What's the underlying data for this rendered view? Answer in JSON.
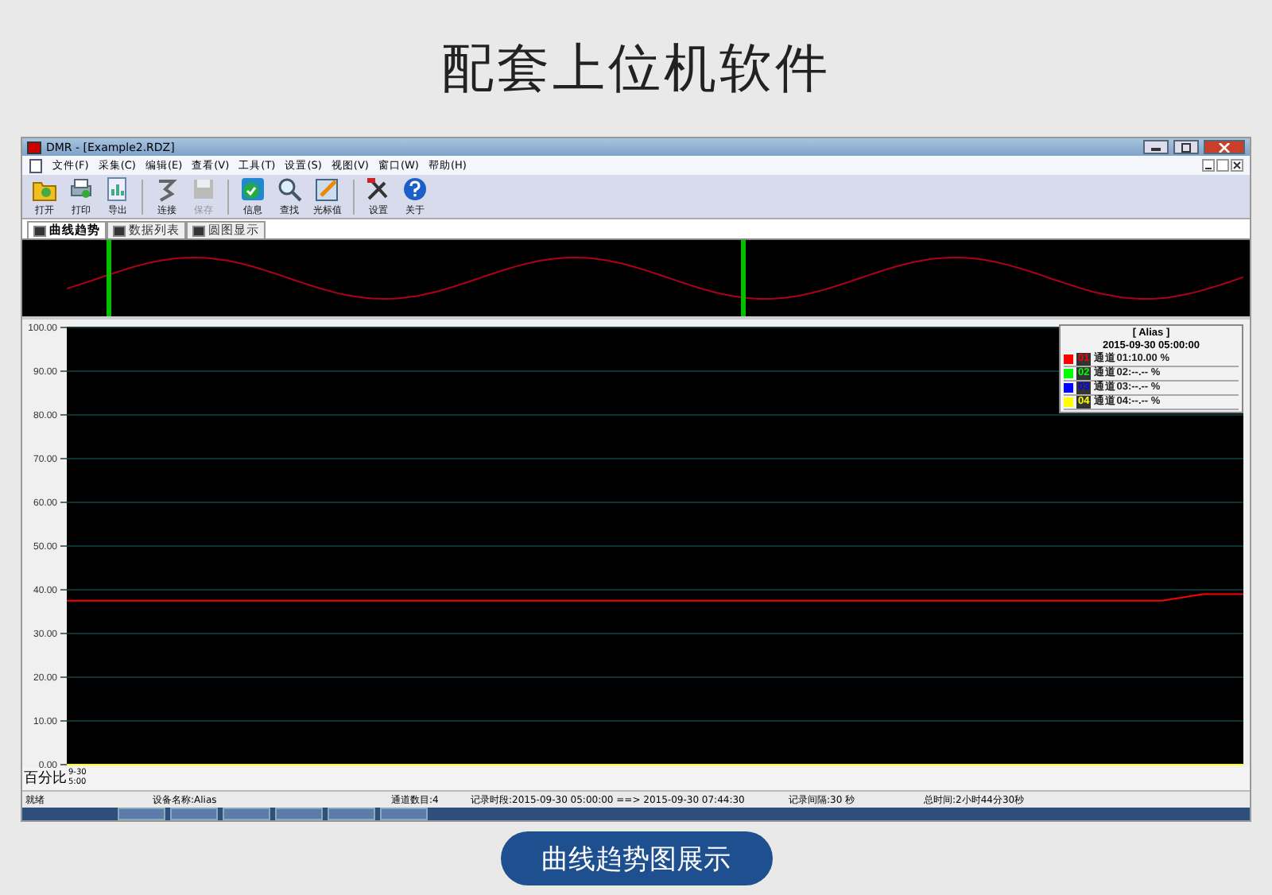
{
  "page_title": "配套上位机软件",
  "window": {
    "title": "DMR - [Example2.RDZ]"
  },
  "menu": [
    "文件(F)",
    "采集(C)",
    "编辑(E)",
    "查看(V)",
    "工具(T)",
    "设置(S)",
    "视图(V)",
    "窗口(W)",
    "帮助(H)"
  ],
  "toolbar": [
    {
      "kind": "open",
      "label": "打开",
      "disabled": false
    },
    {
      "kind": "print",
      "label": "打印",
      "disabled": false
    },
    {
      "kind": "export",
      "label": "导出",
      "disabled": false
    },
    {
      "kind": "connect",
      "label": "连接",
      "disabled": false
    },
    {
      "kind": "save",
      "label": "保存",
      "disabled": true
    },
    {
      "kind": "info",
      "label": "信息",
      "disabled": false
    },
    {
      "kind": "search",
      "label": "查找",
      "disabled": false
    },
    {
      "kind": "cursor",
      "label": "光标值",
      "disabled": false
    },
    {
      "kind": "settings",
      "label": "设置",
      "disabled": false
    },
    {
      "kind": "help",
      "label": "关于",
      "disabled": false
    }
  ],
  "tabs": [
    {
      "label": "曲线趋势",
      "selected": true
    },
    {
      "label": "数据列表",
      "selected": false
    },
    {
      "label": "圆图显示",
      "selected": false
    }
  ],
  "legend": {
    "title": "[ Alias    ]",
    "time": "2015-09-30 05:00:00",
    "channels": [
      {
        "reading": "通道01:10.00 %"
      },
      {
        "reading": "通道02:--.-- %"
      },
      {
        "reading": "通道03:--.-- %"
      },
      {
        "reading": "通道04:--.-- %"
      }
    ]
  },
  "chart_data": {
    "type": "line",
    "ylabel": "百分比",
    "ylim": [
      0,
      100
    ],
    "yticks": [
      {
        "value": 0,
        "label": "0.00"
      },
      {
        "value": 10,
        "label": "10.00"
      },
      {
        "value": 20,
        "label": "20.00"
      },
      {
        "value": 30,
        "label": "30.00"
      },
      {
        "value": 40,
        "label": "40.00"
      },
      {
        "value": 50,
        "label": "50.00"
      },
      {
        "value": 60,
        "label": "60.00"
      },
      {
        "value": 70,
        "label": "70.00"
      },
      {
        "value": 80,
        "label": "80.00"
      },
      {
        "value": 90,
        "label": "90.00"
      },
      {
        "value": 100,
        "label": "100.00"
      }
    ],
    "grid": true,
    "legend": true,
    "series": [
      {
        "name": "01",
        "color": "#ff0000",
        "values": [
          37.5,
          37.5,
          37.5,
          37.5,
          37.5,
          37.5,
          37.5,
          37.5,
          37.5,
          37.5,
          37.5,
          37.5,
          37.5,
          37.5,
          37.5,
          37.5,
          37.5,
          37.5,
          37.5,
          37.5,
          37.5,
          37.5,
          37.5,
          37.5,
          37.5,
          37.5,
          37.5,
          37.5,
          39,
          39
        ]
      },
      {
        "name": "02",
        "color": "#00ff00",
        "values": [
          null,
          null,
          null,
          null,
          null,
          null,
          null,
          null,
          null,
          null,
          null,
          null,
          null,
          null,
          null,
          null,
          null,
          null,
          null,
          null,
          null,
          null,
          null,
          null,
          null,
          null,
          null,
          null,
          null,
          null
        ]
      },
      {
        "name": "03",
        "color": "#0000ff",
        "values": [
          null,
          null,
          null,
          null,
          null,
          null,
          null,
          null,
          null,
          null,
          null,
          null,
          null,
          null,
          null,
          null,
          null,
          null,
          null,
          null,
          null,
          null,
          null,
          null,
          null,
          null,
          null,
          null,
          null,
          null
        ]
      },
      {
        "name": "04",
        "color": "#ffff00",
        "values": [
          0,
          0,
          0,
          0,
          0,
          0,
          0,
          0,
          0,
          0,
          0,
          0,
          0,
          0,
          0,
          0,
          0,
          0,
          0,
          0,
          0,
          0,
          0,
          0,
          0,
          0,
          0,
          0,
          0,
          0
        ]
      }
    ]
  },
  "x_start_label": "9-30\n5:00",
  "status_bar": [
    "就绪",
    "设备名称:Alias",
    "通道数目:4",
    "记录时段:2015-09-30 05:00:00 ==> 2015-09-30 07:44:30",
    "记录间隔:30 秒",
    "总时间:2小时44分30秒"
  ],
  "caption_button": "曲线趋势图展示"
}
